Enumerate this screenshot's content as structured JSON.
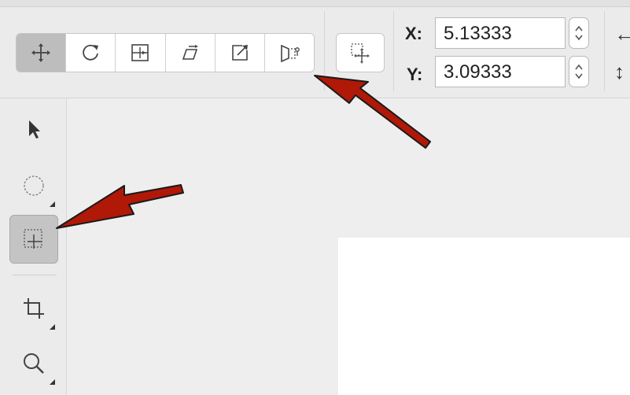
{
  "toolbar": {
    "transform_modes": [
      {
        "icon": "move-icon",
        "active": true
      },
      {
        "icon": "rotate-icon",
        "active": false
      },
      {
        "icon": "resize-icon",
        "active": false
      },
      {
        "icon": "skew-icon",
        "active": false
      },
      {
        "icon": "scale-icon",
        "active": false
      },
      {
        "icon": "flip-icon",
        "active": false
      }
    ],
    "crosshair_button_icon": "selection-move-icon"
  },
  "position": {
    "x_label": "X:",
    "x_value": "5.13333",
    "y_label": "Y:",
    "y_value": "3.09333"
  },
  "sidebar": {
    "tools": [
      {
        "icon": "arrow-pointer-icon",
        "active": false
      },
      {
        "icon": "ellipse-select-icon",
        "active": false
      },
      {
        "icon": "marquee-move-icon",
        "active": true
      },
      {
        "icon": "crop-icon",
        "active": false
      },
      {
        "icon": "zoom-icon",
        "active": false
      }
    ]
  },
  "colors": {
    "annotation_arrow": "#b01808",
    "active_tool_bg": "#c4c4c4"
  }
}
